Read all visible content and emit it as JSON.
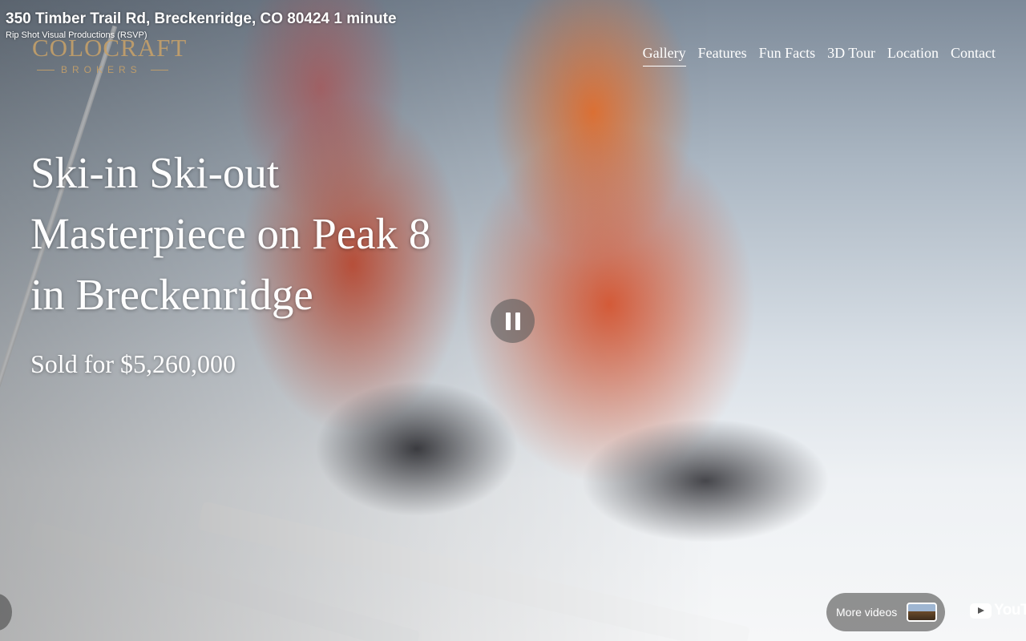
{
  "video": {
    "title": "350 Timber Trail Rd, Breckenridge, CO 80424 1 minute",
    "channel": "Rip Shot Visual Productions (RSVP)",
    "more_videos_label": "More videos",
    "youtube_wordmark": "YouTube"
  },
  "logo": {
    "wordmark": "COLOCRAFT",
    "subtitle": "BROKERS"
  },
  "nav": {
    "items": [
      {
        "label": "Gallery",
        "active": true
      },
      {
        "label": "Features"
      },
      {
        "label": "Fun Facts"
      },
      {
        "label": "3D Tour"
      },
      {
        "label": "Location"
      },
      {
        "label": "Contact"
      }
    ]
  },
  "hero": {
    "headline_lines": [
      "Ski-in Ski-out",
      "Masterpiece on Peak 8",
      "in Breckenridge"
    ],
    "sold_text": "Sold for $5,260,000"
  },
  "colors": {
    "logo_gold": "#c4a069",
    "text": "#ffffff"
  }
}
